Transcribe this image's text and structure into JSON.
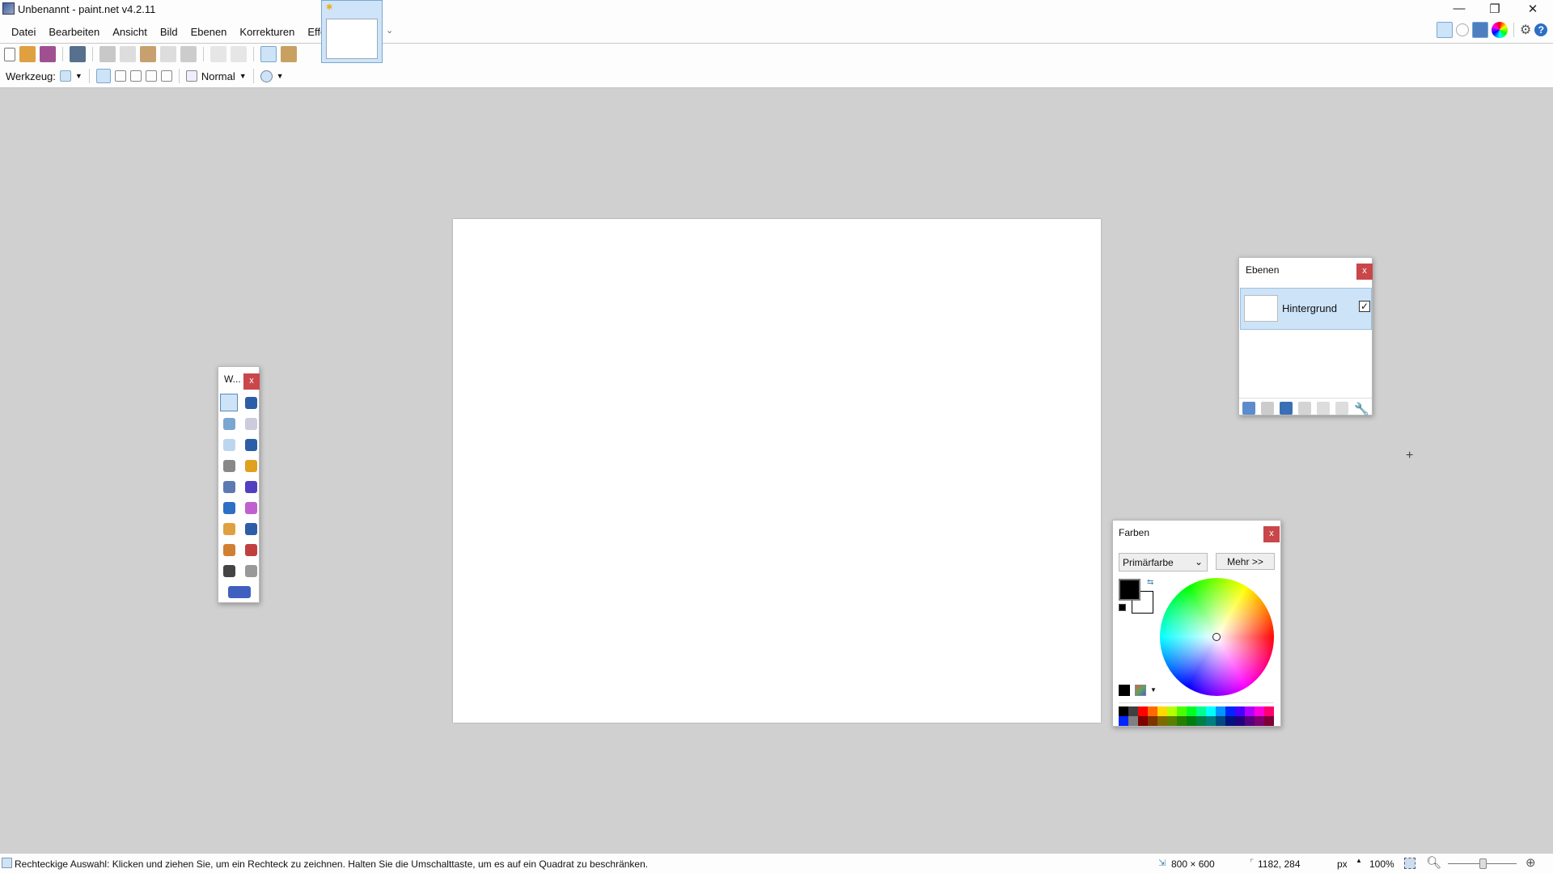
{
  "window": {
    "title": "Unbenannt - paint.net v4.2.11",
    "minimize": "—",
    "restore": "❐",
    "close": "✕"
  },
  "menu": [
    "Datei",
    "Bearbeiten",
    "Ansicht",
    "Bild",
    "Ebenen",
    "Korrekturen",
    "Effekte"
  ],
  "toolbar": {
    "icons": [
      "new-icon",
      "open-icon",
      "save-icon",
      "print-icon",
      "cut-icon",
      "copy-icon",
      "paste-icon",
      "crop-icon",
      "deselect-icon",
      "undo-icon",
      "redo-icon",
      "grid-icon",
      "ruler-icon"
    ]
  },
  "tool_options": {
    "tool_label": "Werkzeug:",
    "blend_mode": "Normal"
  },
  "right_toolbar": {
    "icons": [
      "tools-icon",
      "history-icon",
      "layers-icon",
      "colors-icon",
      "settings-icon",
      "help-icon"
    ]
  },
  "tools_window": {
    "title": "W...",
    "close": "x",
    "tools": [
      "rectangle-select",
      "move-selected-pixels",
      "lasso-select",
      "move-selection",
      "ellipse-select",
      "zoom",
      "magic-wand",
      "pan",
      "paint-bucket",
      "gradient",
      "paintbrush",
      "eraser",
      "pencil",
      "color-picker",
      "clone-stamp",
      "recolor",
      "text",
      "line-curve",
      "shapes"
    ]
  },
  "layers_window": {
    "title": "Ebenen",
    "close": "x",
    "layers": [
      {
        "name": "Hintergrund",
        "visible": true
      }
    ],
    "actions": [
      "add-layer",
      "delete-layer",
      "duplicate-layer",
      "merge-layer-down",
      "move-layer-up",
      "move-layer-down",
      "layer-properties"
    ]
  },
  "colors_window": {
    "title": "Farben",
    "close": "x",
    "mode": "Primärfarbe",
    "more": "Mehr >>",
    "primary": "#000000",
    "secondary": "#ffffff",
    "palette_top": [
      "#000000",
      "#404040",
      "#ff0000",
      "#ff6a00",
      "#ffd800",
      "#b6ff00",
      "#4cff00",
      "#00ff21",
      "#00ff90",
      "#00ffff",
      "#0094ff",
      "#0026ff",
      "#4800ff",
      "#b200ff",
      "#ff00dc",
      "#ff006e"
    ],
    "palette_bottom": [
      "#0026ff",
      "#808080",
      "#7f0000",
      "#7f3300",
      "#7f6a00",
      "#5b7f00",
      "#267f00",
      "#007f0e",
      "#007f46",
      "#007f7f",
      "#004a7f",
      "#00137f",
      "#21007f",
      "#57007f",
      "#7f006e",
      "#7f0037"
    ]
  },
  "status": {
    "hint": "Rechteckige Auswahl: Klicken und ziehen Sie, um ein Rechteck zu zeichnen. Halten Sie die Umschalttaste, um es auf ein Quadrat zu beschränken.",
    "image_size": "800 × 600",
    "cursor": "1182, 284",
    "unit": "px",
    "zoom": "100%",
    "zoom_slider": 0.5
  }
}
